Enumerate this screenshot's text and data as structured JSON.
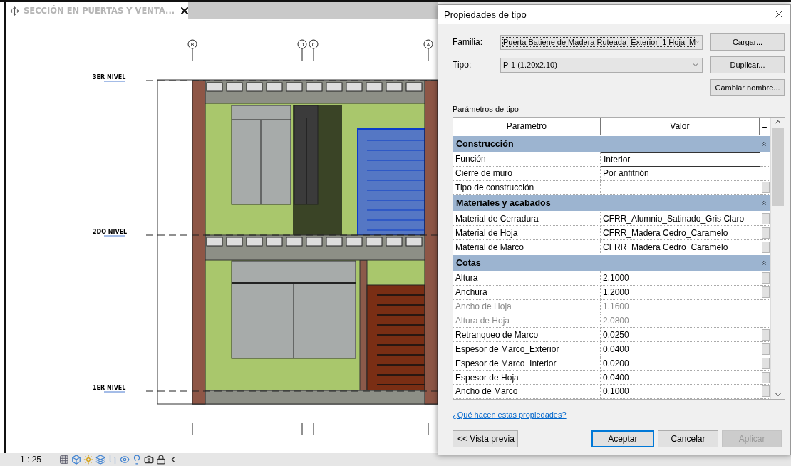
{
  "view_tab": {
    "title": "SECCIÓN EN PUERTAS Y VENTA...",
    "active": true
  },
  "drawing": {
    "grids": [
      {
        "label": "B"
      },
      {
        "label": "D"
      },
      {
        "label": "C"
      },
      {
        "label": "A"
      }
    ],
    "levels": [
      {
        "name": "3ER NIVEL"
      },
      {
        "name": "2DO NIVEL"
      },
      {
        "name": "1ER NIVEL"
      }
    ]
  },
  "status_bar": {
    "scale": "1 : 25"
  },
  "dialog": {
    "title": "Propiedades de tipo",
    "fields": [
      {
        "label": "Familia:",
        "value": "Puerta Batiene de Madera Ruteada_Exterior_1 Hoja_M",
        "focused": true
      },
      {
        "label": "Tipo:",
        "value": "P-1 (1.20x2.10)",
        "focused": false
      }
    ],
    "side_buttons": [
      "Cargar...",
      "Duplicar...",
      "Cambiar nombre..."
    ],
    "params_label": "Parámetros de tipo",
    "columns": [
      "Parámetro",
      "Valor"
    ],
    "filter": "=",
    "groups": [
      {
        "name": "Construcción",
        "expanded": true,
        "rows": [
          {
            "name": "Función",
            "value": "Interior",
            "disabled": false,
            "editing": true,
            "associate": false
          },
          {
            "name": "Cierre de muro",
            "value": "Por anfitrión",
            "disabled": false,
            "editing": false,
            "associate": false
          },
          {
            "name": "Tipo de construcción",
            "disabled": false,
            "editing": false,
            "associate": true
          }
        ]
      },
      {
        "name": "Materiales y acabados",
        "expanded": true,
        "rows": [
          {
            "name": "Material de Cerradura",
            "value": "CFRR_Alumnio_Satinado_Gris Claro",
            "disabled": false,
            "editing": false,
            "associate": true
          },
          {
            "name": "Material de Hoja",
            "value": "CFRR_Madera Cedro_Caramelo",
            "disabled": false,
            "editing": false,
            "associate": true
          },
          {
            "name": "Material de Marco",
            "value": "CFRR_Madera Cedro_Caramelo",
            "disabled": false,
            "editing": false,
            "associate": true
          }
        ]
      },
      {
        "name": "Cotas",
        "expanded": true,
        "rows": [
          {
            "name": "Altura",
            "value": "2.1000",
            "disabled": false,
            "editing": false,
            "associate": true
          },
          {
            "name": "Anchura",
            "value": "1.2000",
            "disabled": false,
            "editing": false,
            "associate": true
          },
          {
            "name": "Ancho de Hoja",
            "value": "1.1600",
            "disabled": true,
            "editing": false,
            "associate": false
          },
          {
            "name": "Altura de Hoja",
            "value": "2.0800",
            "disabled": true,
            "editing": false,
            "associate": false
          },
          {
            "name": "Retranqueo de Marco",
            "value": "0.0250",
            "disabled": false,
            "editing": false,
            "associate": true
          },
          {
            "name": "Espesor de Marco_Exterior",
            "value": "0.0400",
            "disabled": false,
            "editing": false,
            "associate": true
          },
          {
            "name": "Espesor de Marco_Interior",
            "value": "0.0200",
            "disabled": false,
            "editing": false,
            "associate": true
          },
          {
            "name": "Espesor de Hoja",
            "value": "0.0400",
            "disabled": false,
            "editing": false,
            "associate": true
          },
          {
            "name": "Ancho de Marco",
            "value": "0.1000",
            "disabled": false,
            "editing": false,
            "associate": true
          }
        ]
      }
    ],
    "help_link": "¿Qué hacen estas propiedades?",
    "footer_buttons": [
      {
        "label": "<< Vista previa",
        "kind": "left",
        "disabled": false,
        "default": false
      },
      {
        "label": "Aceptar",
        "kind": "right",
        "disabled": false,
        "default": true
      },
      {
        "label": "Cancelar",
        "kind": "right",
        "disabled": false,
        "default": false
      },
      {
        "label": "Aplicar",
        "kind": "right",
        "disabled": true,
        "default": false
      }
    ]
  }
}
